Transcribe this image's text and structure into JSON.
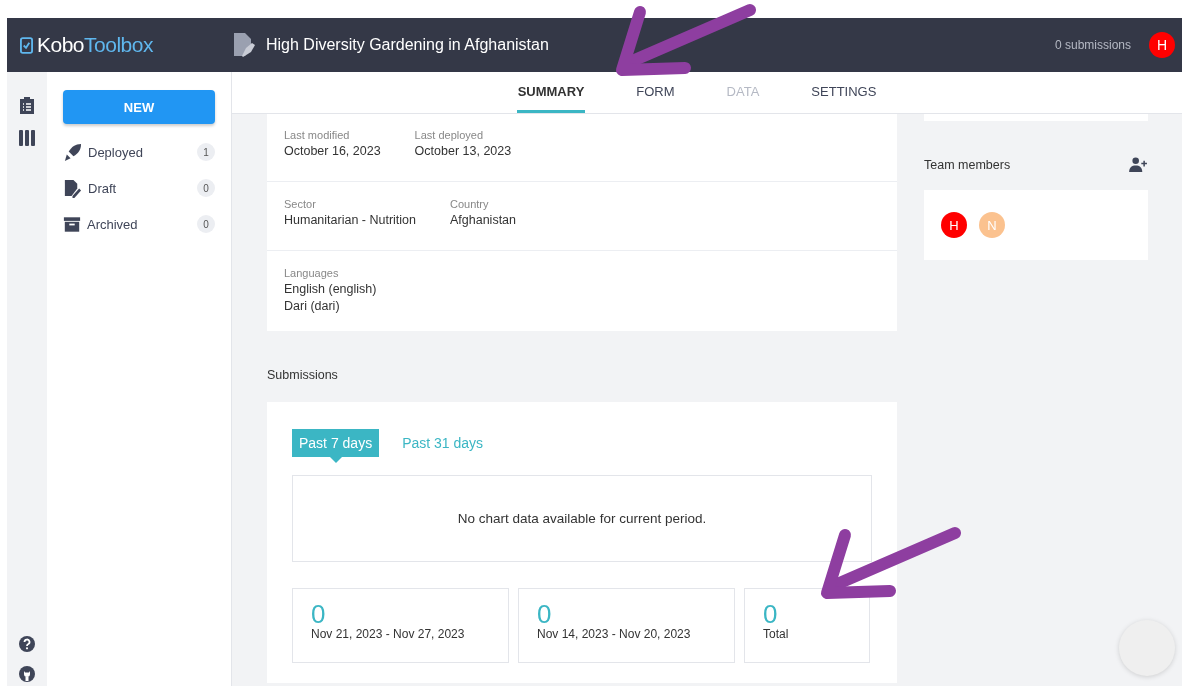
{
  "header": {
    "logo_part_1": "Kobo",
    "logo_part_2": "Toolbox",
    "title": "High Diversity Gardening in Afghanistan",
    "submissions": "0 submissions",
    "avatar": "H"
  },
  "sidebar": {
    "new_button": "NEW",
    "items": [
      {
        "kind": "deployed",
        "label": "Deployed",
        "count": "1"
      },
      {
        "kind": "draft",
        "label": "Draft",
        "count": "0"
      },
      {
        "kind": "archived",
        "label": "Archived",
        "count": "0"
      }
    ]
  },
  "tabs": [
    {
      "label": "SUMMARY",
      "selected": true,
      "disabled": false
    },
    {
      "label": "FORM",
      "selected": false,
      "disabled": false
    },
    {
      "label": "DATA",
      "selected": false,
      "disabled": true
    },
    {
      "label": "SETTINGS",
      "selected": false,
      "disabled": false
    }
  ],
  "details": [
    [
      {
        "label": "Last modified",
        "values": [
          "October 16, 2023"
        ]
      },
      {
        "label": "Last deployed",
        "values": [
          "October 13, 2023"
        ]
      }
    ],
    [
      {
        "label": "Sector",
        "values": [
          "Humanitarian - Nutrition"
        ]
      },
      {
        "label": "Country",
        "values": [
          "Afghanistan"
        ]
      }
    ],
    [
      {
        "label": "Languages",
        "values": [
          "English (english)",
          "Dari (dari)"
        ]
      }
    ]
  ],
  "team": {
    "title": "Team members",
    "members": [
      {
        "initial": "H",
        "color": "#ff0000"
      },
      {
        "initial": "N",
        "color": "#fbc28f"
      }
    ]
  },
  "submissions": {
    "title": "Submissions",
    "periods": [
      {
        "label": "Past 7 days",
        "selected": true
      },
      {
        "label": "Past 31 days",
        "selected": false
      }
    ],
    "empty_message": "No chart data available for current period.",
    "stats": [
      {
        "value": "0",
        "label": "Nov 21, 2023 - Nov 27, 2023"
      },
      {
        "value": "0",
        "label": "Nov 14, 2023 - Nov 20, 2023"
      },
      {
        "value": "0",
        "label": "Total"
      }
    ]
  }
}
